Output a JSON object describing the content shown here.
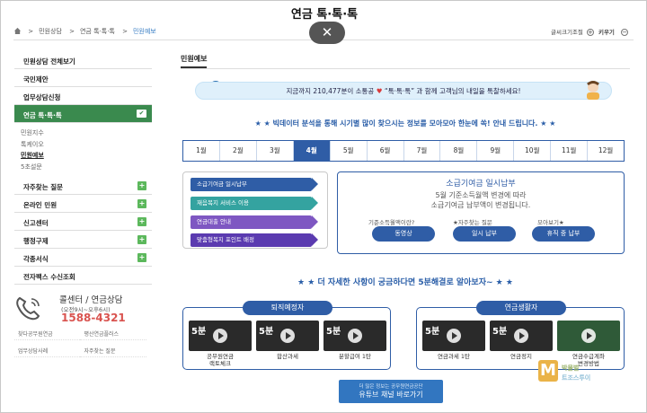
{
  "page_title": "연금 톡·톡·톡",
  "breadcrumb": [
    "민원상담",
    "연금 톡·톡·톡",
    "민원예보"
  ],
  "close_symbol": "✕",
  "font_size": {
    "label": "글씨크기조절",
    "bigger": "키우기",
    "smaller": "작게",
    "plus": "+",
    "minus": "−"
  },
  "sidebar": {
    "items": [
      {
        "label": "민원상담 전체보기"
      },
      {
        "label": "국민제안"
      },
      {
        "label": "업무상담신청"
      },
      {
        "label": "연금 톡·톡·톡",
        "active": true
      }
    ],
    "sub_items": [
      "민원지수",
      "톡케이오",
      "민원예보",
      "5초설문"
    ],
    "items2": [
      "자주찾는 질문",
      "온라인 민원",
      "신고센터",
      "행정구제",
      "각종서식",
      "전자팩스 수신조회"
    ],
    "plus_symbol": "+",
    "check_symbol": "✔"
  },
  "call": {
    "title": "콜센터 / 연금상담",
    "hours": "(오전9시~오후6시)",
    "number": "1588-4321"
  },
  "quick_links": [
    "찾다공무원연금",
    "평산연금플러스",
    "업무상담사례",
    "자주찾는 질문"
  ],
  "main": {
    "tab": "민원예보",
    "banner_pre": "지금까지 210,477분이 소통공",
    "banner_heart": "♥",
    "banner_mid": "“톡·톡·톡”",
    "banner_post": "과 함께 고객님의 내일을 톡찰하세요!",
    "lead": "★ ★ 빅데이터 분석을 통해 시기별 많이 찾으시는 정보를 모아모아 한눈에 쏙! 안내 드립니다. ★ ★",
    "months": [
      "1월",
      "2월",
      "3월",
      "4월",
      "5월",
      "6월",
      "7월",
      "8월",
      "9월",
      "10월",
      "11월",
      "12월"
    ],
    "selected_month": "4월",
    "topics": [
      {
        "label": "소급기여금 일시납부",
        "color": "#2f5da6"
      },
      {
        "label": "재음복지 서비스 이용",
        "color": "#34a3a0"
      },
      {
        "label": "연금대출 안내",
        "color": "#7e57c2"
      },
      {
        "label": "맞춤형복지 포인트 배정",
        "color": "#5b3bb0"
      }
    ],
    "detail": {
      "title": "소급기여금 일시납부",
      "line1": "5월 기준소득월액 변경에 따라",
      "line2": "소급기여금 납부액이 변경됩니다.",
      "labels": [
        "기준소득월액이란?",
        "★자주찾는 질문",
        "모아보기★"
      ],
      "pills": [
        "동영상",
        "일시 납부",
        "휴직 중 납부"
      ]
    },
    "more_heading": "★ ★ 더 자세한 사항이 궁금하다면 5분해결로 알아보자~ ★ ★",
    "panels": [
      {
        "tag": "퇴직예정자",
        "videos": [
          "공무원연금\n랙토체크",
          "합산과세",
          "분할급여 1탄"
        ]
      },
      {
        "tag": "연금생활자",
        "videos": [
          "연금과세 1탄",
          "연금정지",
          "연금수급계좌\n변경방법"
        ]
      }
    ],
    "video_badge": "5분",
    "youtube": {
      "line1": "더 많은 정보는 공무원연금공단",
      "line2": "유튜브 채널 바로가기"
    }
  },
  "watermark": {
    "letter": "M",
    "line1": "박물벌",
    "line2": "트조스투이"
  }
}
